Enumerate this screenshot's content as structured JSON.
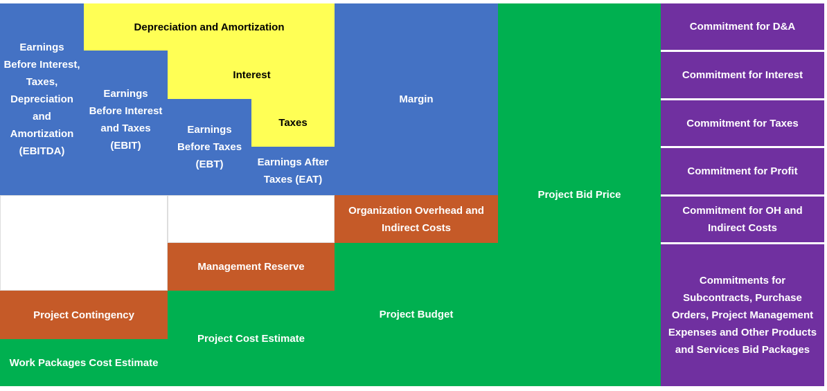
{
  "colors": {
    "earnings": "#4472C4",
    "deductions": "#FFFF55",
    "budget": "#00B050",
    "reserves": "#C55A28",
    "commitments": "#7030A0"
  },
  "blocks": {
    "ebitda": "Earnings Before Interest, Taxes, Depreciation and Amortization (EBITDA)",
    "da": "Depreciation and Amortization",
    "ebit": "Earnings Before Interest and Taxes (EBIT)",
    "interest": "Interest",
    "ebt": "Earnings Before Taxes (EBT)",
    "taxes": "Taxes",
    "eat": "Earnings After Taxes (EAT)",
    "margin": "Margin",
    "overhead": "Organization Overhead and Indirect Costs",
    "management_reserve": "Management Reserve",
    "contingency": "Project Contingency",
    "work_packages": "Work Packages Cost Estimate",
    "cost_estimate": "Project Cost Estimate",
    "budget": "Project Budget",
    "bid_price": "Project Bid Price"
  },
  "commitments": [
    "Commitment for D&A",
    "Commitment for Interest",
    "Commitment for Taxes",
    "Commitment for Profit",
    "Commitment for OH and Indirect Costs",
    "Commitments for Subcontracts, Purchase Orders, Project Management Expenses and Other Products and Services Bid Packages"
  ]
}
